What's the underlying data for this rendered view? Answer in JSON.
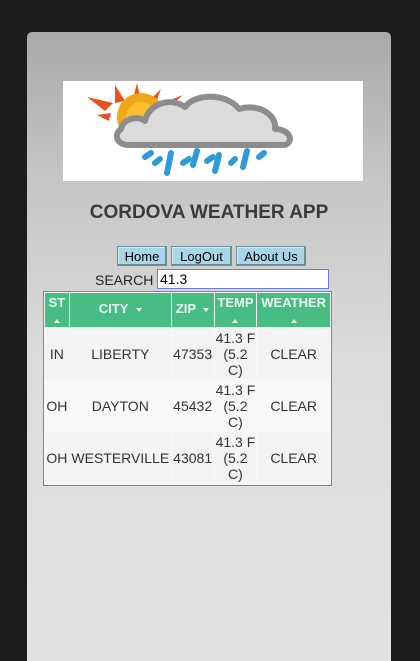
{
  "app": {
    "title": "CORDOVA WEATHER APP"
  },
  "nav": [
    {
      "label": "Home"
    },
    {
      "label": "LogOut"
    },
    {
      "label": "About Us"
    }
  ],
  "search": {
    "label": "SEARCH",
    "value": "41.3"
  },
  "table": {
    "columns": [
      {
        "label": "ST",
        "sort": "asc"
      },
      {
        "label": "CITY",
        "sort": "desc"
      },
      {
        "label": "ZIP",
        "sort": "desc"
      },
      {
        "label": "TEMP",
        "sort": "asc"
      },
      {
        "label": "WEATHER",
        "sort": "asc"
      }
    ],
    "rows": [
      {
        "st": "IN",
        "city": "LIBERTY",
        "zip": "47353",
        "temp": "41.3 F (5.2 C)",
        "weather": "CLEAR"
      },
      {
        "st": "OH",
        "city": "DAYTON",
        "zip": "45432",
        "temp": "41.3 F (5.2 C)",
        "weather": "CLEAR"
      },
      {
        "st": "OH",
        "city": "WESTERVILLE",
        "zip": "43081",
        "temp": "41.3 F (5.2 C)",
        "weather": "CLEAR"
      }
    ]
  },
  "colors": {
    "header_bg": "#48bd83",
    "table_border": "#3daa75",
    "button_bg": "#a9d6e6",
    "title_text": "#3a3a3a",
    "search_border": "#6b7fe0"
  },
  "icons": {
    "logo": "sun-cloud-rain-icon",
    "sort_asc": "sort-up-icon",
    "sort_desc": "sort-down-icon"
  }
}
